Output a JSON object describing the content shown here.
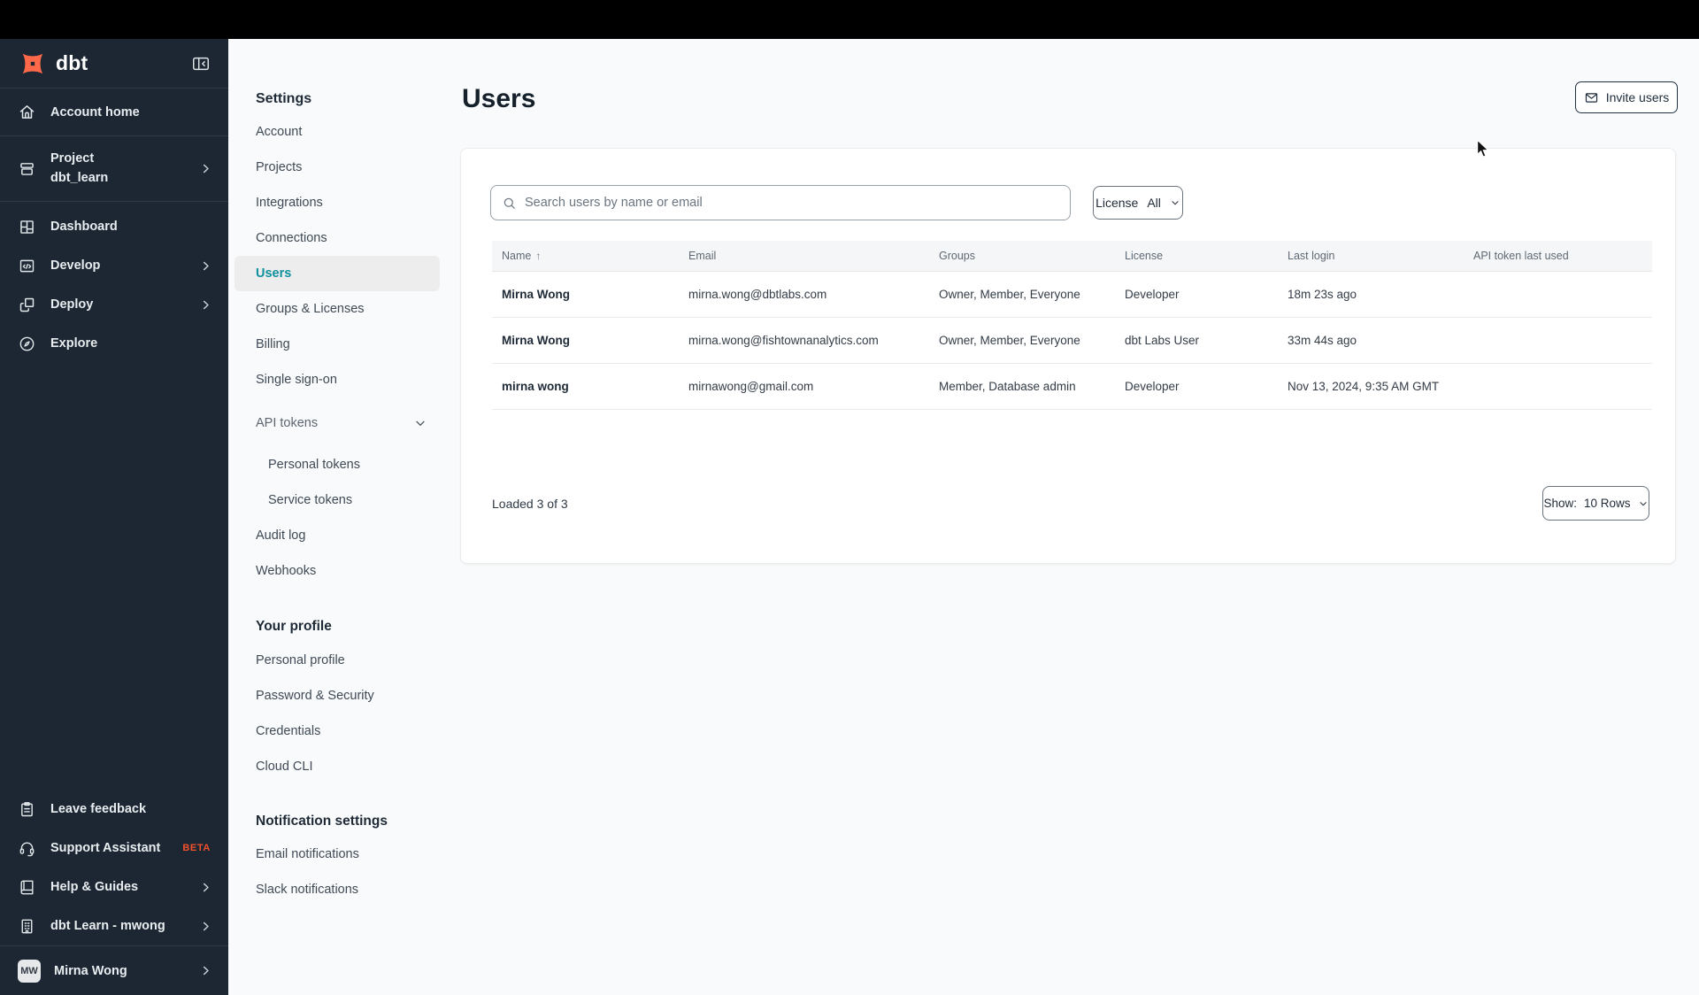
{
  "colors": {
    "sidebar_bg": "#1c2733",
    "accent_orange": "#ff694a",
    "beta_orange": "#f4502c",
    "active_teal": "#11909e",
    "card_bg": "#ffffff",
    "page_bg": "#f9fafb"
  },
  "sidebar": {
    "logo_text": "dbt",
    "items": [
      {
        "label": "Account home"
      },
      {
        "label": "Project",
        "sublabel": "dbt_learn"
      },
      {
        "label": "Dashboard"
      },
      {
        "label": "Develop"
      },
      {
        "label": "Deploy"
      },
      {
        "label": "Explore"
      }
    ],
    "footer_items": [
      {
        "label": "Leave feedback"
      },
      {
        "label": "Support Assistant",
        "badge": "BETA"
      },
      {
        "label": "Help & Guides"
      },
      {
        "label": "dbt Learn - mwong"
      }
    ],
    "user": {
      "initials": "MW",
      "name": "Mirna Wong"
    }
  },
  "settings_nav": {
    "title": "Settings",
    "items": [
      {
        "label": "Account"
      },
      {
        "label": "Projects"
      },
      {
        "label": "Integrations"
      },
      {
        "label": "Connections"
      },
      {
        "label": "Users"
      },
      {
        "label": "Groups & Licenses"
      },
      {
        "label": "Billing"
      },
      {
        "label": "Single sign-on"
      },
      {
        "label": "API tokens"
      },
      {
        "label": "Personal tokens"
      },
      {
        "label": "Service tokens"
      },
      {
        "label": "Audit log"
      },
      {
        "label": "Webhooks"
      }
    ],
    "profile_title": "Your profile",
    "profile_items": [
      {
        "label": "Personal profile"
      },
      {
        "label": "Password & Security"
      },
      {
        "label": "Credentials"
      },
      {
        "label": "Cloud CLI"
      }
    ],
    "notifications_title": "Notification settings",
    "notification_items": [
      {
        "label": "Email notifications"
      },
      {
        "label": "Slack notifications"
      }
    ]
  },
  "main": {
    "title": "Users",
    "invite_button": "Invite users",
    "search": {
      "placeholder": "Search users by name or email"
    },
    "filter": {
      "label": "License",
      "value": "All"
    },
    "table": {
      "headers": [
        "Name",
        "Email",
        "Groups",
        "License",
        "Last login",
        "API token last used"
      ],
      "sort_indicator": "↑",
      "rows": [
        {
          "name": "Mirna Wong",
          "email": "mirna.wong@dbtlabs.com",
          "groups": "Owner, Member, Everyone",
          "license": "Developer",
          "last_login": "18m 23s ago",
          "api_token_last_used": ""
        },
        {
          "name": "Mirna Wong",
          "email": "mirna.wong@fishtownanalytics.com",
          "groups": "Owner, Member, Everyone",
          "license": "dbt Labs User",
          "last_login": "33m 44s ago",
          "api_token_last_used": ""
        },
        {
          "name": "mirna wong",
          "email": "mirnawong@gmail.com",
          "groups": "Member, Database admin",
          "license": "Developer",
          "last_login": "Nov 13, 2024, 9:35 AM GMT",
          "api_token_last_used": ""
        }
      ]
    },
    "footer": {
      "loaded": "Loaded 3 of 3",
      "show_label": "Show:",
      "show_value": "10 Rows"
    }
  }
}
